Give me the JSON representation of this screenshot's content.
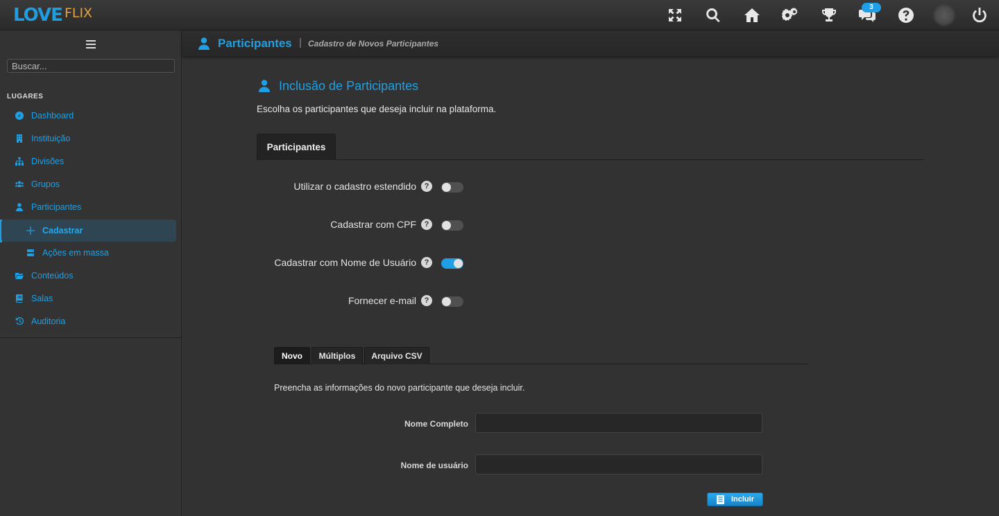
{
  "app": {
    "logo_left": "LOVE",
    "logo_right": "FLIX"
  },
  "topbar": {
    "icons": [
      "fullscreen-icon",
      "search-icon",
      "home-icon",
      "gears-icon",
      "trophy-icon",
      "chat-icon",
      "help-icon",
      "avatar",
      "power-icon"
    ],
    "notification_count": "3"
  },
  "sidebar": {
    "search_placeholder": "Buscar...",
    "section_title": "LUGARES",
    "items": [
      {
        "label": "Dashboard",
        "icon": "dashboard-icon"
      },
      {
        "label": "Instituição",
        "icon": "building-icon"
      },
      {
        "label": "Divisões",
        "icon": "sitemap-icon"
      },
      {
        "label": "Grupos",
        "icon": "users-icon"
      },
      {
        "label": "Participantes",
        "icon": "user-icon"
      },
      {
        "label": "Cadastrar",
        "icon": "plus-icon",
        "active": true
      },
      {
        "label": "Ações em massa",
        "icon": "server-icon"
      },
      {
        "label": "Conteúdos",
        "icon": "folder-icon"
      },
      {
        "label": "Salas",
        "icon": "book-icon"
      },
      {
        "label": "Auditoria",
        "icon": "history-icon"
      }
    ]
  },
  "breadcrumb": {
    "title": "Participantes",
    "separator": "|",
    "subtitle": "Cadastro de Novos Participantes"
  },
  "main": {
    "title": "Inclusão de Participantes",
    "description": "Escolha os participantes que deseja incluir na plataforma.",
    "tab": "Participantes",
    "options": [
      {
        "label": "Utilizar o cadastro estendido",
        "help": "?",
        "on": false
      },
      {
        "label": "Cadastrar com CPF",
        "help": "?",
        "on": false
      },
      {
        "label": "Cadastrar com Nome de Usuário",
        "help": "?",
        "on": true
      },
      {
        "label": "Fornecer e-mail",
        "help": "?",
        "on": false
      }
    ],
    "subtabs": [
      "Novo",
      "Múltiplos",
      "Arquivo CSV"
    ],
    "form_description": "Preencha as informações do novo participante que deseja incluir.",
    "fields": [
      {
        "label": "Nome Completo",
        "value": ""
      },
      {
        "label": "Nome de usuário",
        "value": ""
      }
    ],
    "submit_label": "Incluir"
  },
  "colors": {
    "accent": "#1fa0e4",
    "logo_orange": "#e6a33a",
    "background": "#323232"
  }
}
